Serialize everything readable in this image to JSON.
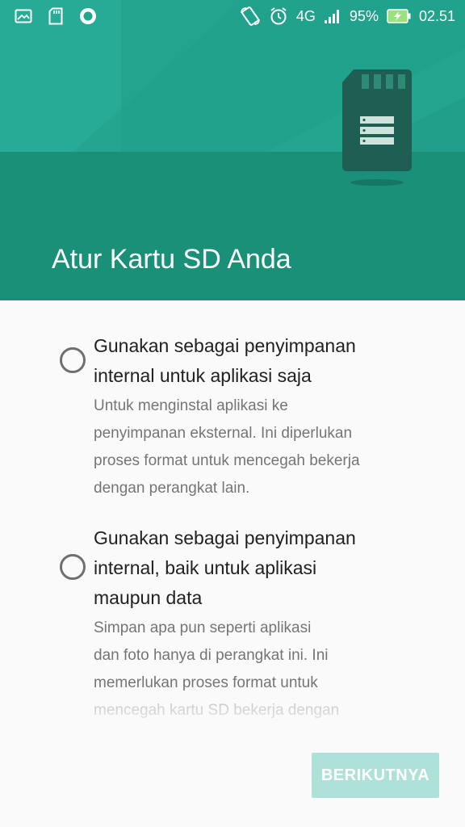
{
  "status_bar": {
    "network": "4G",
    "battery_percent": "95%",
    "time": "02.51",
    "left_icons": [
      "image-icon",
      "sd-card-icon",
      "circle-notification-icon"
    ],
    "right_icons": [
      "rotate-icon",
      "alarm-icon",
      "signal-icon",
      "battery-charging-icon"
    ]
  },
  "header": {
    "title": "Atur Kartu SD Anda",
    "illustration": "sd-card-icon"
  },
  "options": [
    {
      "title": "Gunakan sebagai penyimpanan internal untuk aplikasi saja",
      "title_lines": [
        "Gunakan sebagai penyimpanan",
        "internal untuk aplikasi saja"
      ],
      "desc_lines": [
        "Untuk menginstal aplikasi ke",
        "penyimpanan eksternal. Ini diperlukan",
        "proses format untuk mencegah bekerja",
        "dengan perangkat lain."
      ],
      "selected": false
    },
    {
      "title": "Gunakan sebagai penyimpanan internal, baik untuk aplikasi maupun data",
      "title_lines": [
        "Gunakan sebagai penyimpanan",
        "internal, baik untuk aplikasi",
        "maupun data"
      ],
      "desc_lines": [
        "Simpan apa pun seperti aplikasi",
        "dan foto hanya di perangkat ini. Ini",
        "memerlukan proses format untuk",
        "mencegah kartu SD bekerja dengan"
      ],
      "selected": false
    }
  ],
  "footer": {
    "next_label": "BERIKUTNYA"
  },
  "colors": {
    "header_dark": "#1a9079",
    "header_light": "#23a590",
    "button_disabled": "#aee2d8",
    "radio": "#6f6f6f"
  }
}
